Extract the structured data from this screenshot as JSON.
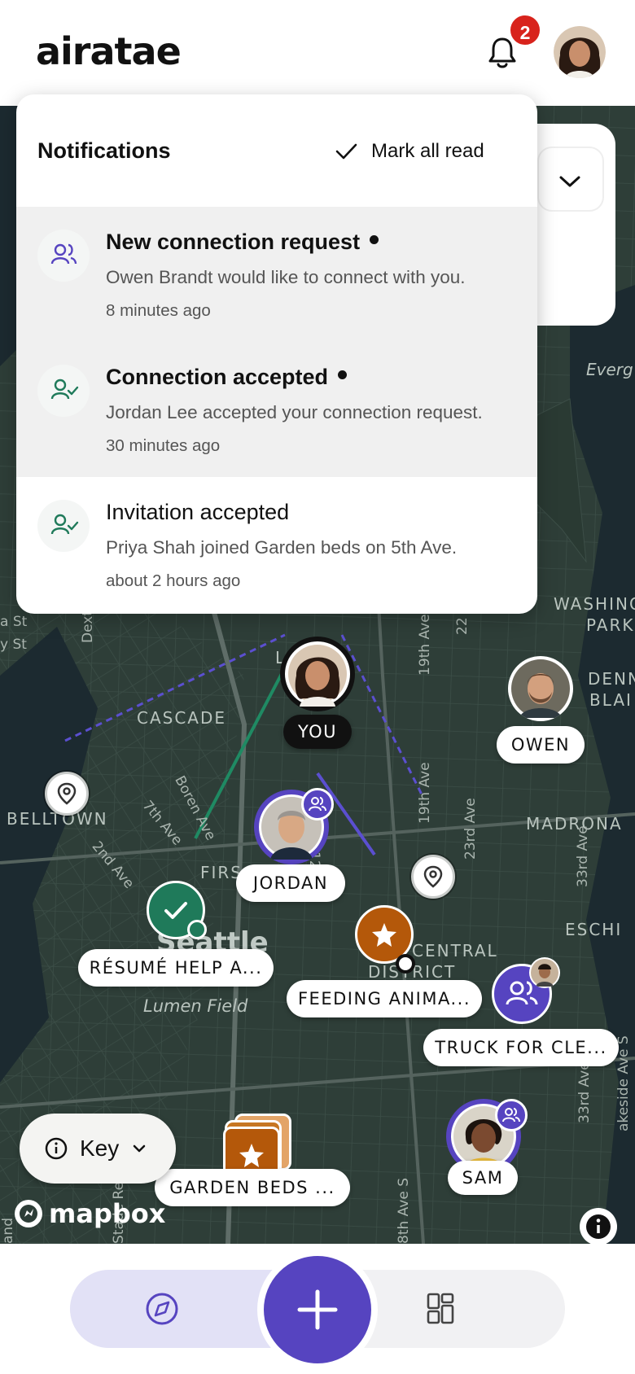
{
  "app": {
    "logo": "airatae",
    "notification_count": "2"
  },
  "notifications": {
    "title": "Notifications",
    "mark_all_label": "Mark all read",
    "items": [
      {
        "title": "New connection request",
        "body": "Owen Brandt would like to connect with you.",
        "time": "8 minutes ago",
        "unread": true,
        "icon": "people-icon"
      },
      {
        "title": "Connection accepted",
        "body": "Jordan Lee accepted your connection request.",
        "time": "30 minutes ago",
        "unread": true,
        "icon": "user-check-icon"
      },
      {
        "title": "Invitation accepted",
        "body": "Priya Shah joined Garden beds on 5th Ave.",
        "time": "about 2 hours ago",
        "unread": false,
        "icon": "user-check-icon"
      }
    ]
  },
  "map": {
    "neighborhoods": {
      "cascade": "CASCADE",
      "belltown": "BELLTOWN",
      "madrona": "MADRONA",
      "central": "CENTRAL",
      "district": "DISTRICT",
      "first": "FIRS",
      "seattle": "Seattle",
      "lumen": "Lumen Field",
      "washing": "WASHING",
      "park": "PARK",
      "denny": "DENN",
      "blaine": "BLAI",
      "leschi": "ESCHI",
      "evergreen": "Everg",
      "cut_l": "L"
    },
    "streets": {
      "s1": "a St",
      "s2": "y St",
      "s3": "Dexte",
      "s4": "Boren Ave",
      "s5": "7th Ave",
      "s6": "2nd Ave",
      "s7": "19th Ave",
      "s8": "19th Ave",
      "s9": "23rd Ave",
      "s10": "22",
      "s11": "33rd Ave",
      "s12": "33rd Ave S",
      "s13": "akeside Ave S",
      "s14": "8th Ave S",
      "s15": "Stade Re",
      "s16": "and",
      "s17": "12",
      "s18": "S"
    },
    "people": {
      "you": "YOU",
      "owen": "OWEN",
      "jordan": "JORDAN",
      "sam": "SAM"
    },
    "places": {
      "resume": "RÉSUMÉ HELP A...",
      "feeding": "FEEDING ANIMA...",
      "truck": "TRUCK FOR CLE...",
      "garden": "GARDEN BEDS ..."
    },
    "key_label": "Key",
    "attribution": "mapbox"
  },
  "nav": {
    "items": [
      "explore-icon",
      "add-icon",
      "grid-icon"
    ]
  },
  "colors": {
    "accent": "#5644c0",
    "green": "#1f7a5a",
    "orange": "#b4580a",
    "map": "#2d3d37"
  }
}
